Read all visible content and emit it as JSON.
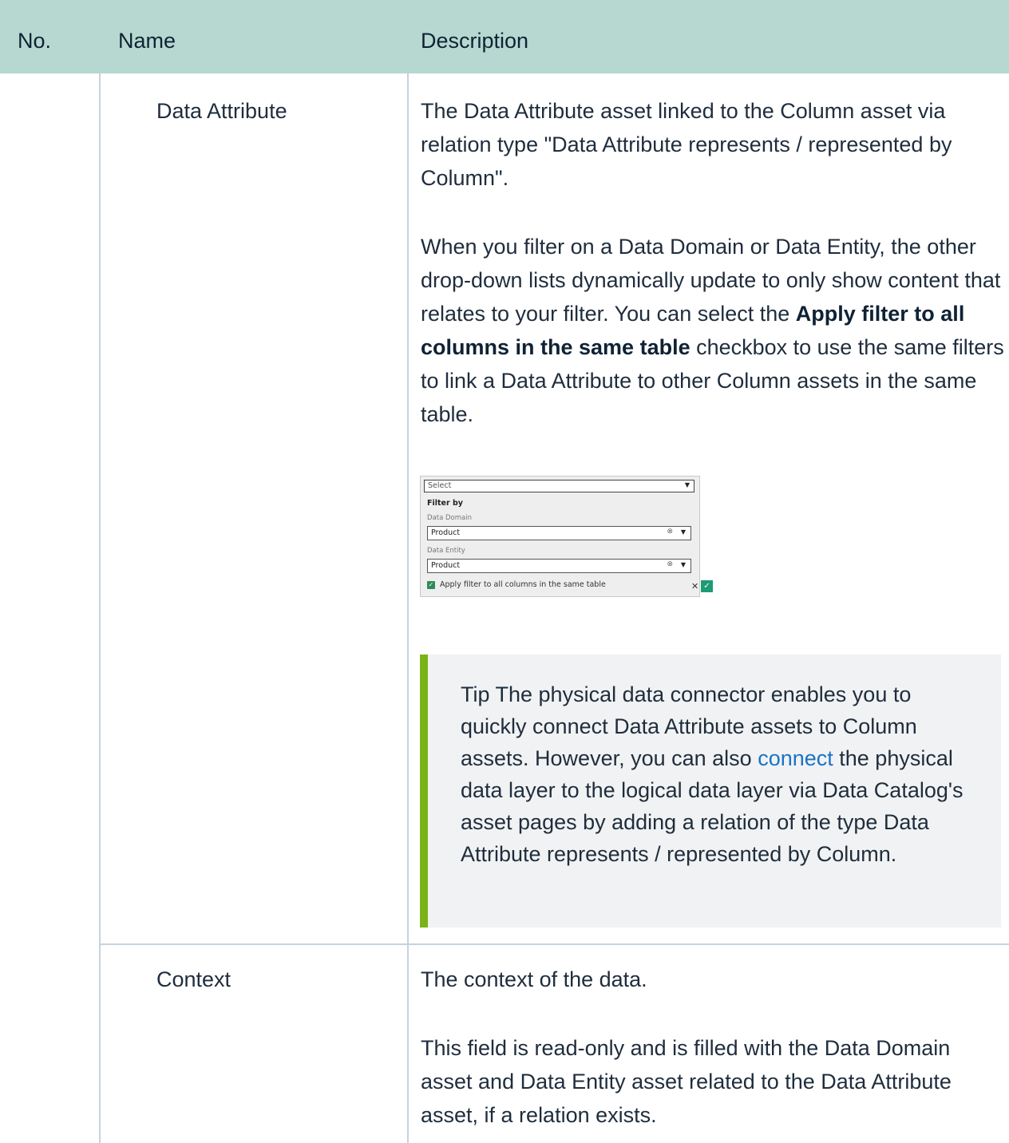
{
  "table": {
    "headers": {
      "no": "No.",
      "name": "Name",
      "description": "Description"
    },
    "rows": [
      {
        "name": "Data Attribute",
        "description": [
          "The Data Attribute asset linked to the Column asset via relation type \"Data Attribute represents / represented by Column\".",
          {
            "before": "When you filter on a Data Domain or Data Entity, the other drop-down lists dynamically update to only show content that relates to your filter. You can select the ",
            "bold": "Apply filter to all columns in the same table",
            "after": " checkbox to use the same filters to link a Data Attribute to other Column assets in the same table."
          }
        ],
        "tip": {
          "before": "Tip   The physical data connector enables you to quickly connect Data Attribute assets to Column assets. However, you can also ",
          "link": "connect",
          "after": " the physical data layer to the logical data layer via Data Catalog's asset pages by adding a relation of the type Data Attribute represents / represented by Column."
        }
      },
      {
        "name": "Context",
        "description": [
          "The context of the data.",
          "This field is read-only and is filled with the Data Domain asset and Data Entity asset related to the Data Attribute asset, if a relation exists."
        ]
      }
    ]
  },
  "filter_screenshot": {
    "select_placeholder": "Select",
    "filter_by": "Filter by",
    "domain_label": "Data Domain",
    "domain_value": "Product",
    "entity_label": "Data Entity",
    "entity_value": "Product",
    "checkbox_label": "Apply filter to all columns in the same table",
    "checkbox_checked": true
  }
}
